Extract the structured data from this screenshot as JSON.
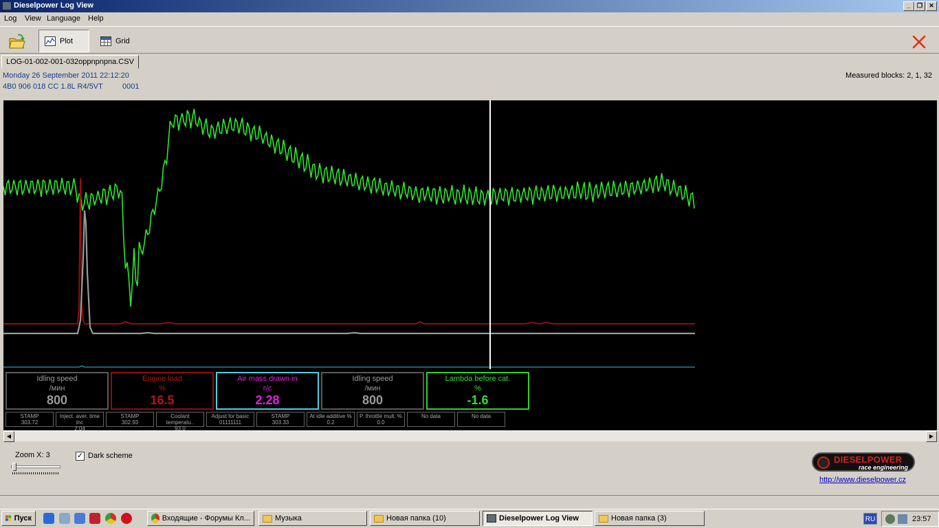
{
  "window": {
    "title": "Dieselpower Log View"
  },
  "menu": [
    "Log",
    "View",
    "Language",
    "Help"
  ],
  "toolbar": {
    "plot_label": "Plot",
    "grid_label": "Grid"
  },
  "file_tab": "LOG-01-002-001-032oppnpnpna.CSV",
  "info": {
    "datetime": "Monday 26 September 2011 22:12:20",
    "ecu": "4B0 906 018 CC  1.8L R4/5VT",
    "code": "0001",
    "measured_blocks": "Measured blocks: 2, 1, 32"
  },
  "gauges": [
    {
      "name": "Idling speed",
      "unit": "/мин",
      "value": "800",
      "color": "#9a9a9a"
    },
    {
      "name": "Engine load",
      "unit": "%",
      "value": "16.5",
      "color": "#b01818"
    },
    {
      "name": "Air mass drawn in",
      "unit": "г/с",
      "value": "2.28",
      "color": "#e020e0",
      "border": "#4fd0e0"
    },
    {
      "name": "Idling speed",
      "unit": "/мин",
      "value": "800",
      "color": "#9a9a9a"
    },
    {
      "name": "Lambda before cat.",
      "unit": "%",
      "value": "-1.6",
      "color": "#30e030"
    }
  ],
  "mini": [
    {
      "name": "STAMP",
      "value": "303.72"
    },
    {
      "name": "Inject. aver. time inc",
      "value": "2.04"
    },
    {
      "name": "STAMP",
      "value": "302.93"
    },
    {
      "name": "Coolant temperatu..",
      "value": "93.0"
    },
    {
      "name": "Adjust for basic",
      "value": "01111111"
    },
    {
      "name": "STAMP",
      "value": "303.33"
    },
    {
      "name": "At idle additive %",
      "value": "0.2"
    },
    {
      "name": "P. throttle mult. %",
      "value": "0.0"
    },
    {
      "name": "No data",
      "value": ""
    },
    {
      "name": "No data",
      "value": ""
    }
  ],
  "zoom": {
    "label": "Zoom X: 3"
  },
  "dark_scheme": {
    "label": "Dark scheme",
    "checked": true
  },
  "brand": {
    "name": "DIESELPOWER",
    "tagline": "race engineering",
    "url": "http://www.dieselpower.cz"
  },
  "taskbar": {
    "start": "Пуск",
    "tasks": [
      "Входящие - Форумы Кл...",
      "Музыка",
      "Новая папка (10)",
      "Dieselpower Log View",
      "Новая папка (3)"
    ],
    "lang": "RU",
    "clock": "23:57"
  }
}
